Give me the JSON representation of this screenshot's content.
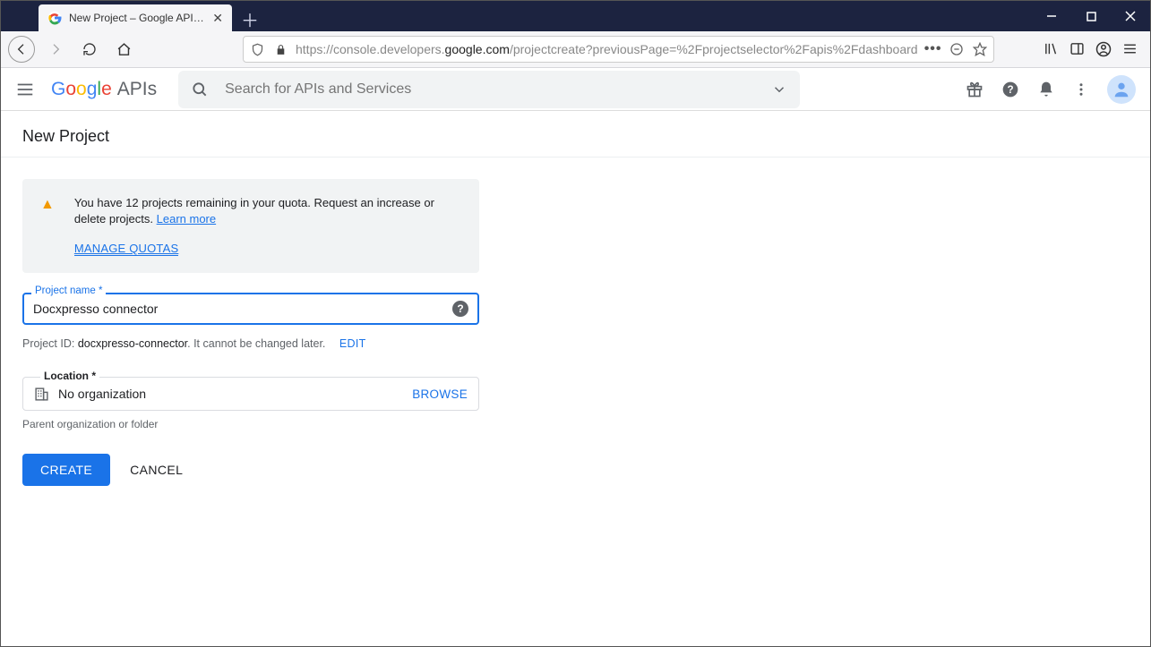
{
  "browser": {
    "tab_title": "New Project – Google API Cons",
    "url_prefix": "https://console.developers.",
    "url_host_bold": "google.com",
    "url_path": "/projectcreate?previousPage=%2Fprojectselector%2Fapis%2Fdashboard"
  },
  "header": {
    "logo_apis": "APIs",
    "search_placeholder": "Search for APIs and Services"
  },
  "page": {
    "title": "New Project"
  },
  "quota": {
    "message": "You have 12 projects remaining in your quota. Request an increase or delete projects. ",
    "learn_more": "Learn more",
    "manage": "MANAGE QUOTAS"
  },
  "project_name": {
    "label": "Project name *",
    "value": "Docxpresso connector"
  },
  "project_id": {
    "prefix": "Project ID: ",
    "id": "docxpresso-connector",
    "suffix": ". It cannot be changed later.",
    "edit": "EDIT"
  },
  "location": {
    "label": "Location *",
    "value": "No organization",
    "browse": "BROWSE",
    "hint": "Parent organization or folder"
  },
  "actions": {
    "create": "CREATE",
    "cancel": "CANCEL"
  }
}
